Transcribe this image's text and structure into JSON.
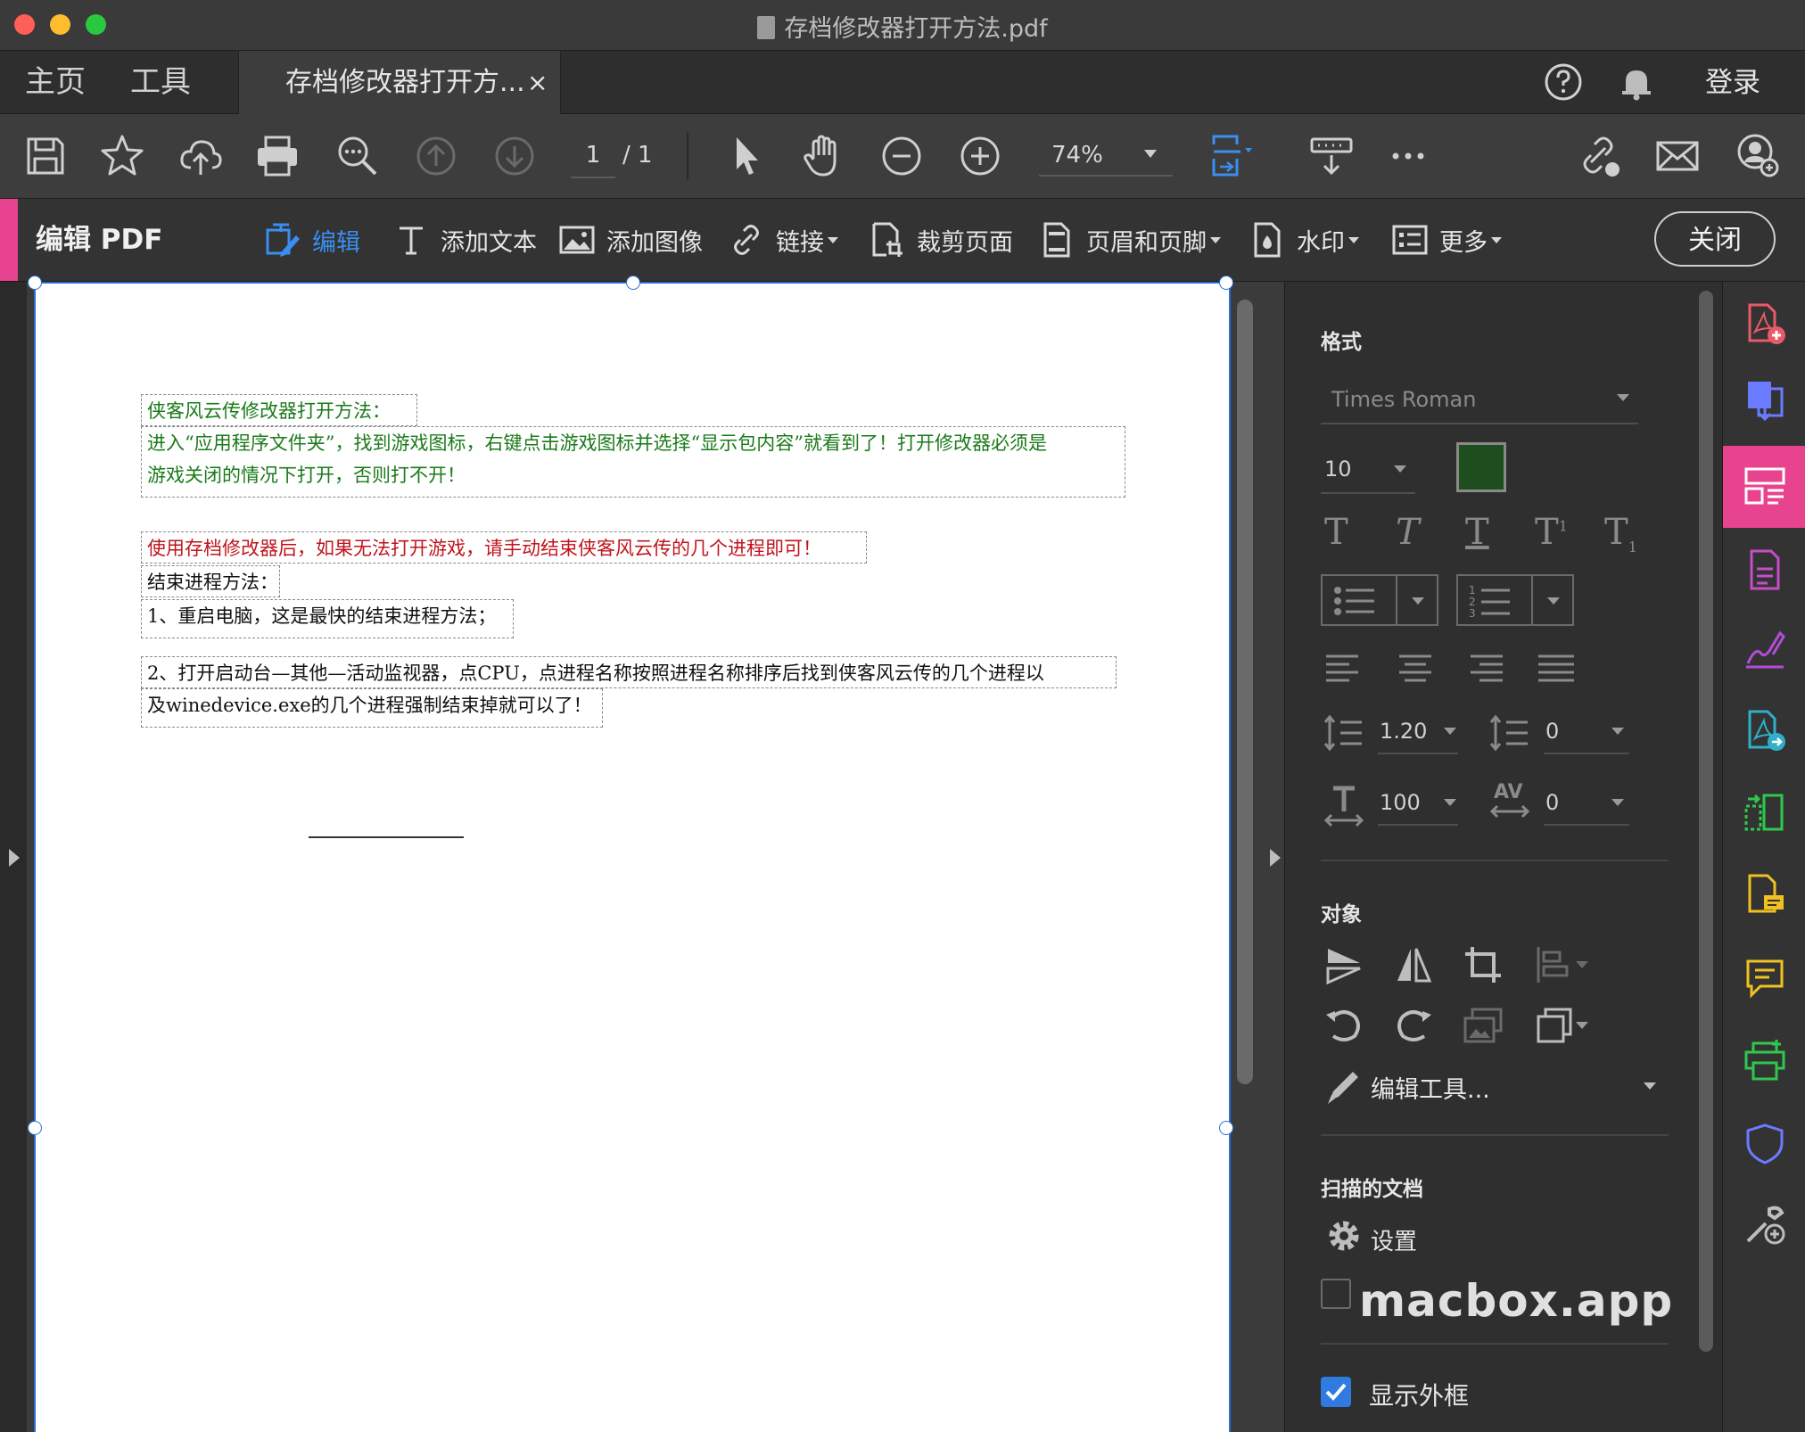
{
  "window": {
    "title": "存档修改器打开方法.pdf"
  },
  "tabs": {
    "home": "主页",
    "tools": "工具",
    "document_tab": "存档修改器打开方...",
    "close_tab": "×",
    "login": "登录"
  },
  "toolbar": {
    "page_current": "1",
    "page_total": "/ 1",
    "zoom": "74%"
  },
  "editbar": {
    "title": "编辑 PDF",
    "edit": "编辑",
    "add_text": "添加文本",
    "add_image": "添加图像",
    "link": "链接",
    "crop": "裁剪页面",
    "header_footer": "页眉和页脚",
    "watermark": "水印",
    "more": "更多",
    "close": "关闭"
  },
  "document": {
    "lines": [
      {
        "text": "侠客风云传修改器打开方法：",
        "color": "#1a7a1a"
      },
      {
        "text": "进入“应用程序文件夹”，找到游戏图标，右键点击游戏图标并选择“显示包内容”就看到了！打开修改器必须是",
        "color": "#1a7a1a"
      },
      {
        "text": "游戏关闭的情况下打开，否则打不开！",
        "color": "#1a7a1a"
      },
      {
        "text": "使用存档修改器后，如果无法打开游戏，请手动结束侠客风云传的几个进程即可！",
        "color": "#c0141e"
      },
      {
        "text": "结束进程方法：",
        "color": "#111111"
      },
      {
        "text": "1、重启电脑，这是最快的结束进程方法；",
        "color": "#111111"
      },
      {
        "text": "2、打开启动台—其他—活动监视器，点CPU，点进程名称按照进程名称排序后找到侠客风云传的几个进程以",
        "color": "#111111"
      },
      {
        "text": "及winedevice.exe的几个进程强制结束掉就可以了！",
        "color": "#111111"
      }
    ]
  },
  "format_panel": {
    "section_format": "格式",
    "font_family": "Times Roman",
    "font_size": "10",
    "text_color": "#1e4d1e",
    "line_spacing": "1.20",
    "paragraph_spacing": "0",
    "horizontal_scale": "100",
    "char_spacing_label": "AV",
    "char_spacing": "0",
    "section_object": "对象",
    "edit_tools": "编辑工具...",
    "section_scanned": "扫描的文档",
    "settings": "设置",
    "show_bbox": "显示外框",
    "show_bbox_checked": true
  },
  "watermark_text": "macbox.app",
  "colors": {
    "accent": "#e8438f",
    "selection": "#2c6fd4",
    "checkbox": "#2f7be0"
  }
}
